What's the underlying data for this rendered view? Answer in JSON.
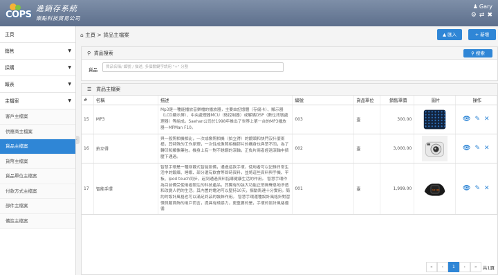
{
  "header": {
    "logo_text": "COPS",
    "title": "進銷存系統",
    "subtitle": "樂點科技貿易公司",
    "user_name": "Gary"
  },
  "sidebar": {
    "items": [
      {
        "label": "主頁",
        "caret": false
      },
      {
        "label": "銷售",
        "caret": true
      },
      {
        "label": "採購",
        "caret": true
      },
      {
        "label": "報表",
        "caret": true
      },
      {
        "label": "主檔案",
        "caret": true
      }
    ],
    "subitems": [
      {
        "label": "客戶主檔案",
        "active": false
      },
      {
        "label": "供應商主檔案",
        "active": false
      },
      {
        "label": "貨品主檔案",
        "active": true
      },
      {
        "label": "貨幣主檔案",
        "active": false
      },
      {
        "label": "貨品單位主檔案",
        "active": false
      },
      {
        "label": "付款方式主檔案",
        "active": false
      },
      {
        "label": "部件主檔案",
        "active": false
      },
      {
        "label": "備註主檔案",
        "active": false
      }
    ]
  },
  "breadcrumb": {
    "home": "主頁",
    "sep": ">",
    "current": "貨品主檔案"
  },
  "buttons": {
    "import": "匯入",
    "add": "新增",
    "search": "搜索"
  },
  "search_panel": {
    "title": "貨品搜索",
    "label": "貨品",
    "placeholder": "貨品名稱/ 編號 / 描述, 多個關鍵字請用 \"+\" 分割"
  },
  "list_panel": {
    "title": "貨品主檔案",
    "columns": [
      "#",
      "名稱",
      "描述",
      "編號",
      "貨品單位",
      "銷售單價",
      "圖片",
      "操作"
    ],
    "rows": [
      {
        "index": "15",
        "name": "MP3",
        "desc": "Mp3是一種能播放音樂檔的播放器，主要由記憶體（存儲卡）、顯示器（LCD顯示屏）、中央處理器MCU（微控制器）或解碼DSP（數位訊號處理器）等組成。Saehan公司於1998年推出了世界上第一台的MP3播放器—MPMan F10。",
        "code": "003",
        "unit": "臺",
        "price": "300.00",
        "pic": "mp3"
      },
      {
        "index": "16",
        "name": "拍立得",
        "desc": "與一般照相機相比，一次成像照相機（拍立得）的鏡頭和快門沒什麼兩樣，其特殊的工作原理，一次性成像照相機膠片的構身也與眾不同，為了轉印和顯像藥包，機身上有一對不銹鋼的滾軸，正負片兩者經過滾軸中擠壓下通過。",
        "code": "002",
        "unit": "臺",
        "price": "3,000.00",
        "pic": "camera"
      },
      {
        "index": "17",
        "name": "智能手環",
        "desc": "智慧手環是一種穿戴式智能設備，通過這款手環，使用者可以記錄日常生活中的鍛煉、睡眠、部分還有飲食等即時資料，並將這些資料與手機、平板、ipod touch同步，起到通過資料指導健康生活的作用。 智慧手環作為目前備受使用者關注的科技產品，其獨有的強大功能正悄無聲息地滲透和改變人們的生活。其內置的電池可以堅持10天，振動馬達十分實用。簡約的設計風格也可以滿足終品的裝飾作用。 智慧手環運種設計風格針對習慣佩戴首飾的用戶而言，提具有誘惑力，更重要的是，手環的設計風格遵循",
        "code": "001",
        "unit": "臺",
        "price": "1,999.00",
        "pic": "band"
      }
    ]
  },
  "pager": {
    "first": "«",
    "prev": "‹",
    "current": "1",
    "next": "›",
    "last": "»",
    "total": "共1頁"
  },
  "colors": {
    "accent": "#2f86d6",
    "header_top": "#7e8fa8",
    "header_bottom": "#5d6f8c"
  }
}
